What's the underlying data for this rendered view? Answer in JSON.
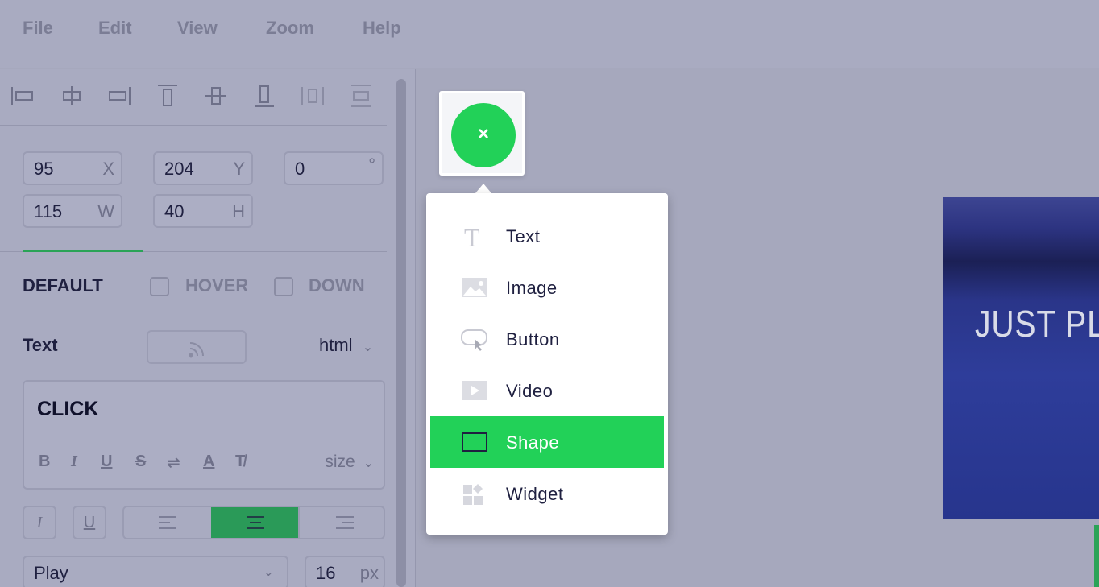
{
  "menubar": {
    "items": [
      "File",
      "Edit",
      "View",
      "Zoom",
      "Help"
    ]
  },
  "properties": {
    "x": {
      "value": "95",
      "suffix": "X"
    },
    "y": {
      "value": "204",
      "suffix": "Y"
    },
    "rotation": {
      "value": "0",
      "suffix": "°"
    },
    "width": {
      "value": "115",
      "suffix": "W"
    },
    "height": {
      "value": "40",
      "suffix": "H"
    }
  },
  "states": {
    "default": "DEFAULT",
    "hover": "HOVER",
    "down": "DOWN"
  },
  "text_section": {
    "label": "Text",
    "mode": "html",
    "content": "CLICK",
    "size_label": "size",
    "format_buttons": [
      "B",
      "I",
      "U",
      "S",
      "⇌",
      "A",
      "T̸"
    ]
  },
  "font": {
    "family": "Play",
    "size": "16",
    "unit": "px",
    "italic_label": "I",
    "underline_label": "U"
  },
  "add_menu": {
    "close_label": "×",
    "items": [
      {
        "label": "Text",
        "icon": "text-icon"
      },
      {
        "label": "Image",
        "icon": "image-icon"
      },
      {
        "label": "Button",
        "icon": "button-icon"
      },
      {
        "label": "Video",
        "icon": "video-icon"
      },
      {
        "label": "Shape",
        "icon": "shape-icon",
        "active": true
      },
      {
        "label": "Widget",
        "icon": "widget-icon"
      }
    ]
  },
  "canvas": {
    "banner_text": "JUST PLA"
  },
  "colors": {
    "accent": "#22d158",
    "active_align": "#2a9a58"
  }
}
